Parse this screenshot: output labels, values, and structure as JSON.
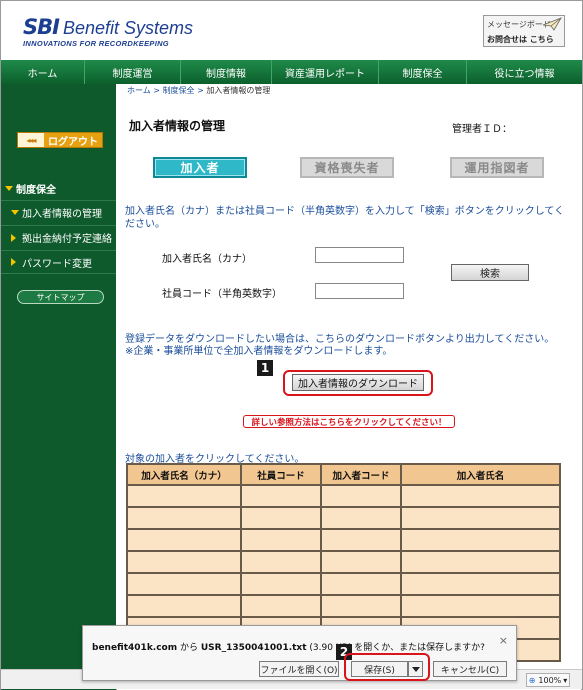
{
  "header": {
    "logo_mark": "SBI",
    "logo_name": "Benefit Systems",
    "tagline": "INNOVATIONS FOR RECORDKEEPING",
    "message_board": "メッセージボード",
    "contact": "お問合せは こちら"
  },
  "nav": [
    "ホーム",
    "制度運営",
    "制度情報",
    "資産運用レポート",
    "制度保全",
    "役に立つ情報"
  ],
  "sidebar": {
    "logout_arrows": "◂◂◂",
    "logout": "ログアウト",
    "section": "制度保全",
    "items": [
      "加入者情報の管理",
      "拠出金納付予定連絡",
      "パスワード変更"
    ],
    "sitemap": "サイトマップ"
  },
  "breadcrumb": {
    "home": "ホーム",
    "sep1": " > ",
    "section": "制度保全",
    "sep2": " > ",
    "current": "加入者情報の管理"
  },
  "page": {
    "title": "加入者情報の管理",
    "admin_label": "管理者ＩＤ："
  },
  "tabs": [
    "加入者",
    "資格喪失者",
    "運用指図者"
  ],
  "search": {
    "instruction": "加入者氏名（カナ）または社員コード（半角英数字）を入力して「検索」ボタンをクリックしてください。",
    "name_label": "加入者氏名（カナ）",
    "code_label": "社員コード（半角英数字）",
    "name_value": "",
    "code_value": "",
    "button": "検索"
  },
  "download": {
    "line1": "登録データをダウンロードしたい場合は、こちらのダウンロードボタンより出力してください。",
    "line2": "※企業・事業所単位で全加入者情報をダウンロードします。",
    "badge": "1",
    "button": "加入者情報のダウンロード",
    "detail": "詳しい参照方法はこちらをクリックしてください！"
  },
  "table": {
    "caption": "対象の加入者をクリックしてください。",
    "headers": [
      "加入者氏名（カナ）",
      "社員コード",
      "加入者コード",
      "加入者氏名"
    ],
    "rows": [
      [
        "",
        "",
        "",
        ""
      ],
      [
        "",
        "",
        "",
        ""
      ],
      [
        "",
        "",
        "",
        ""
      ],
      [
        "",
        "",
        "",
        ""
      ],
      [
        "",
        "",
        "",
        ""
      ],
      [
        "",
        "",
        "",
        ""
      ],
      [
        "",
        "",
        "",
        ""
      ],
      [
        "",
        "",
        "",
        ""
      ]
    ]
  },
  "dialog": {
    "site": "benefit401k.com",
    "from": " から ",
    "file": "USR_1350041001.txt",
    "size": " (3.90 KB) を開くか、または保存しますか?",
    "close": "×",
    "open_btn": "ファイルを開く(O)",
    "save_btn": "保存(S)",
    "cancel_btn": "キャンセル(C)",
    "badge": "2"
  },
  "statusbar": {
    "zoom": "100%"
  },
  "colors": {
    "nav_green": "#1f8b4a",
    "sidebar_green": "#0e5a2c",
    "tab_active": "#2fb9c8",
    "highlight_red": "#d9141b",
    "table_header": "#f2c690",
    "table_cell": "#fbe3c6"
  }
}
